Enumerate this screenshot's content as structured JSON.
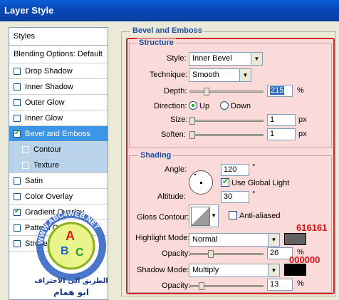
{
  "window": {
    "title": "Layer Style"
  },
  "styles_list": {
    "header": "Styles",
    "blending_options": "Blending Options: Default",
    "items": [
      {
        "label": "Drop Shadow",
        "checked": false
      },
      {
        "label": "Inner Shadow",
        "checked": false
      },
      {
        "label": "Outer Glow",
        "checked": false
      },
      {
        "label": "Inner Glow",
        "checked": false
      },
      {
        "label": "Bevel and Emboss",
        "checked": true
      },
      {
        "label": "Contour",
        "checked": false
      },
      {
        "label": "Texture",
        "checked": false
      },
      {
        "label": "Satin",
        "checked": false
      },
      {
        "label": "Color Overlay",
        "checked": false
      },
      {
        "label": "Gradient Overlay",
        "checked": true
      },
      {
        "label": "Pattern Over",
        "checked": false
      },
      {
        "label": "Stroke",
        "checked": false
      }
    ]
  },
  "panel": {
    "title": "Bevel and Emboss",
    "structure": {
      "title": "Structure",
      "style_label": "Style:",
      "style_value": "Inner Bevel",
      "technique_label": "Technique:",
      "technique_value": "Smooth",
      "depth_label": "Depth:",
      "depth_value": "215",
      "depth_unit": "%",
      "direction_label": "Direction:",
      "direction_up": "Up",
      "direction_down": "Down",
      "size_label": "Size:",
      "size_value": "1",
      "size_unit": "px",
      "soften_label": "Soften:",
      "soften_value": "1",
      "soften_unit": "px"
    },
    "shading": {
      "title": "Shading",
      "angle_label": "Angle:",
      "angle_value": "120",
      "angle_unit": "°",
      "use_global_light": "Use Global Light",
      "altitude_label": "Altitude:",
      "altitude_value": "30",
      "altitude_unit": "°",
      "gloss_contour_label": "Gloss Contour:",
      "anti_aliased": "Anti-aliased",
      "highlight_mode_label": "Highlight Mode:",
      "highlight_mode_value": "Normal",
      "highlight_color": "#616161",
      "highlight_hex": "616161",
      "highlight_opacity_label": "Opacity:",
      "highlight_opacity_value": "26",
      "opacity_unit": "%",
      "shadow_mode_label": "Shadow Mode:",
      "shadow_mode_value": "Multiply",
      "shadow_color": "#000000",
      "shadow_hex": "000000",
      "shadow_opacity_label": "Opacity:",
      "shadow_opacity_value": "13"
    }
  },
  "watermark": {
    "ring_text": "WWW.ABC4WEB.NET",
    "letters": [
      "A",
      "B",
      "C"
    ],
    "arabic_line1": "الطريق الى الاحتراف",
    "arabic_line2": "ابو همام"
  }
}
